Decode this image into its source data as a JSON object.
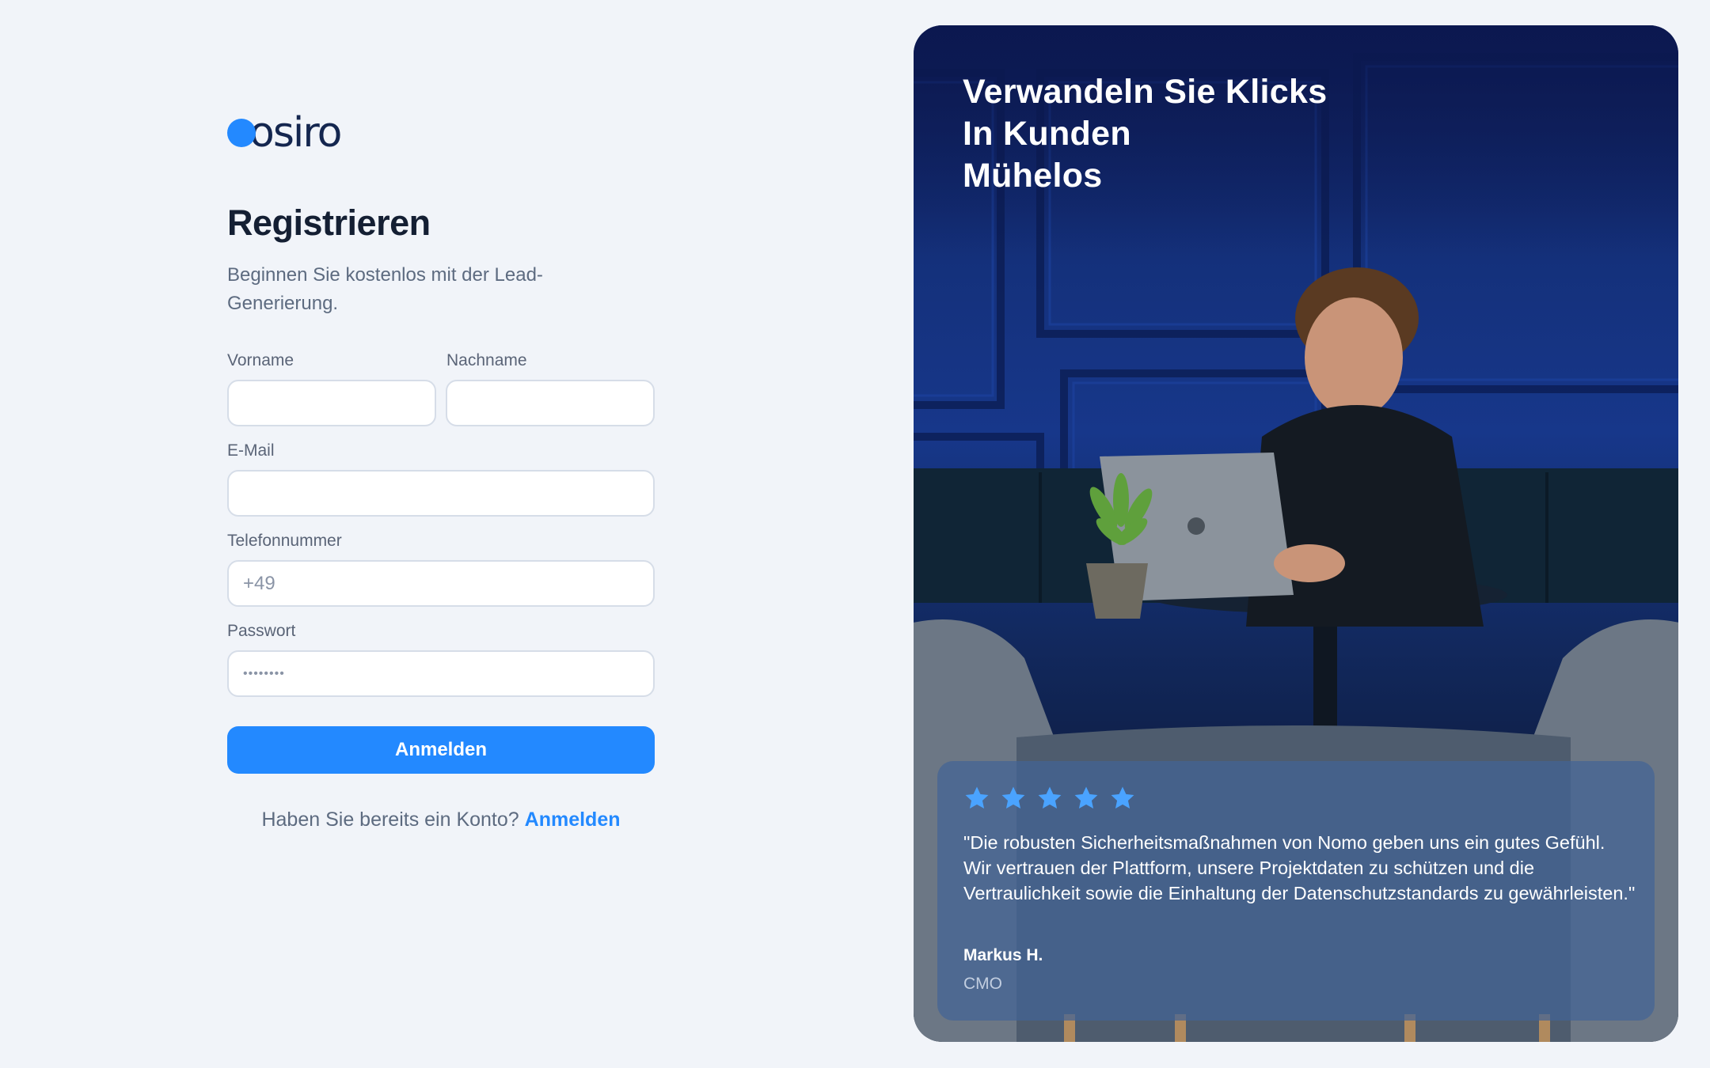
{
  "brand": {
    "logo_text": "osiro",
    "accent_color": "#2389ff"
  },
  "form": {
    "title": "Registrieren",
    "subtitle": "Beginnen Sie kostenlos mit der Lead-Generierung.",
    "first_name": {
      "label": "Vorname",
      "value": "",
      "placeholder": ""
    },
    "last_name": {
      "label": "Nachname",
      "value": "",
      "placeholder": ""
    },
    "email": {
      "label": "E-Mail",
      "value": "",
      "placeholder": ""
    },
    "phone": {
      "label": "Telefonnummer",
      "value": "",
      "placeholder": "+49"
    },
    "password": {
      "label": "Passwort",
      "value": "••••••••"
    },
    "submit_label": "Anmelden",
    "footer_prompt": "Haben Sie bereits ein Konto?",
    "footer_link": "Anmelden"
  },
  "hero": {
    "title_lines": [
      "Verwandeln Sie Klicks",
      "In Kunden",
      "Mühelos"
    ],
    "testimonial": {
      "rating": 5,
      "star_color": "#4aa3ff",
      "quote": "\"Die robusten Sicherheitsmaßnahmen von Nomo geben uns ein gutes Gefühl. Wir vertrauen der Plattform, unsere Projektdaten zu schützen und die Vertraulichkeit sowie die Einhaltung der Datenschutzstandards zu gewährleisten.\"",
      "author": "Markus H.",
      "role": "CMO"
    }
  }
}
